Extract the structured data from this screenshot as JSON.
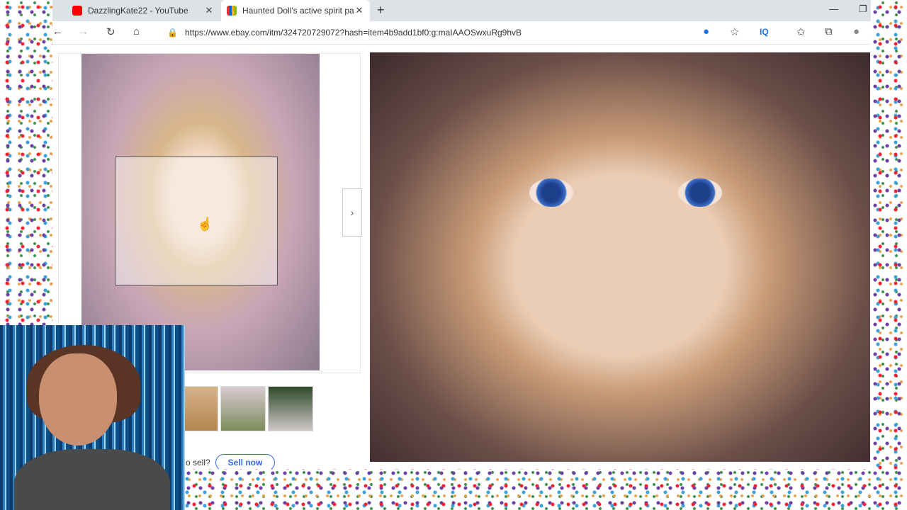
{
  "tabs": [
    {
      "title": "DazzlingKate22 - YouTube",
      "favicon": "youtube-icon",
      "color": "#ff0000"
    },
    {
      "title": "Haunted Doll's active spirit para",
      "favicon": "ebay-icon",
      "color": "#e53238"
    }
  ],
  "address_bar": {
    "url": "https://www.ebay.com/itm/324720729072?hash=item4b9add1bf0:g:maIAAOSwxuRg9hvB"
  },
  "toolbar_badge": "IQ",
  "listing": {
    "sell_prompt": "o sell?",
    "sell_button": "Sell now"
  }
}
